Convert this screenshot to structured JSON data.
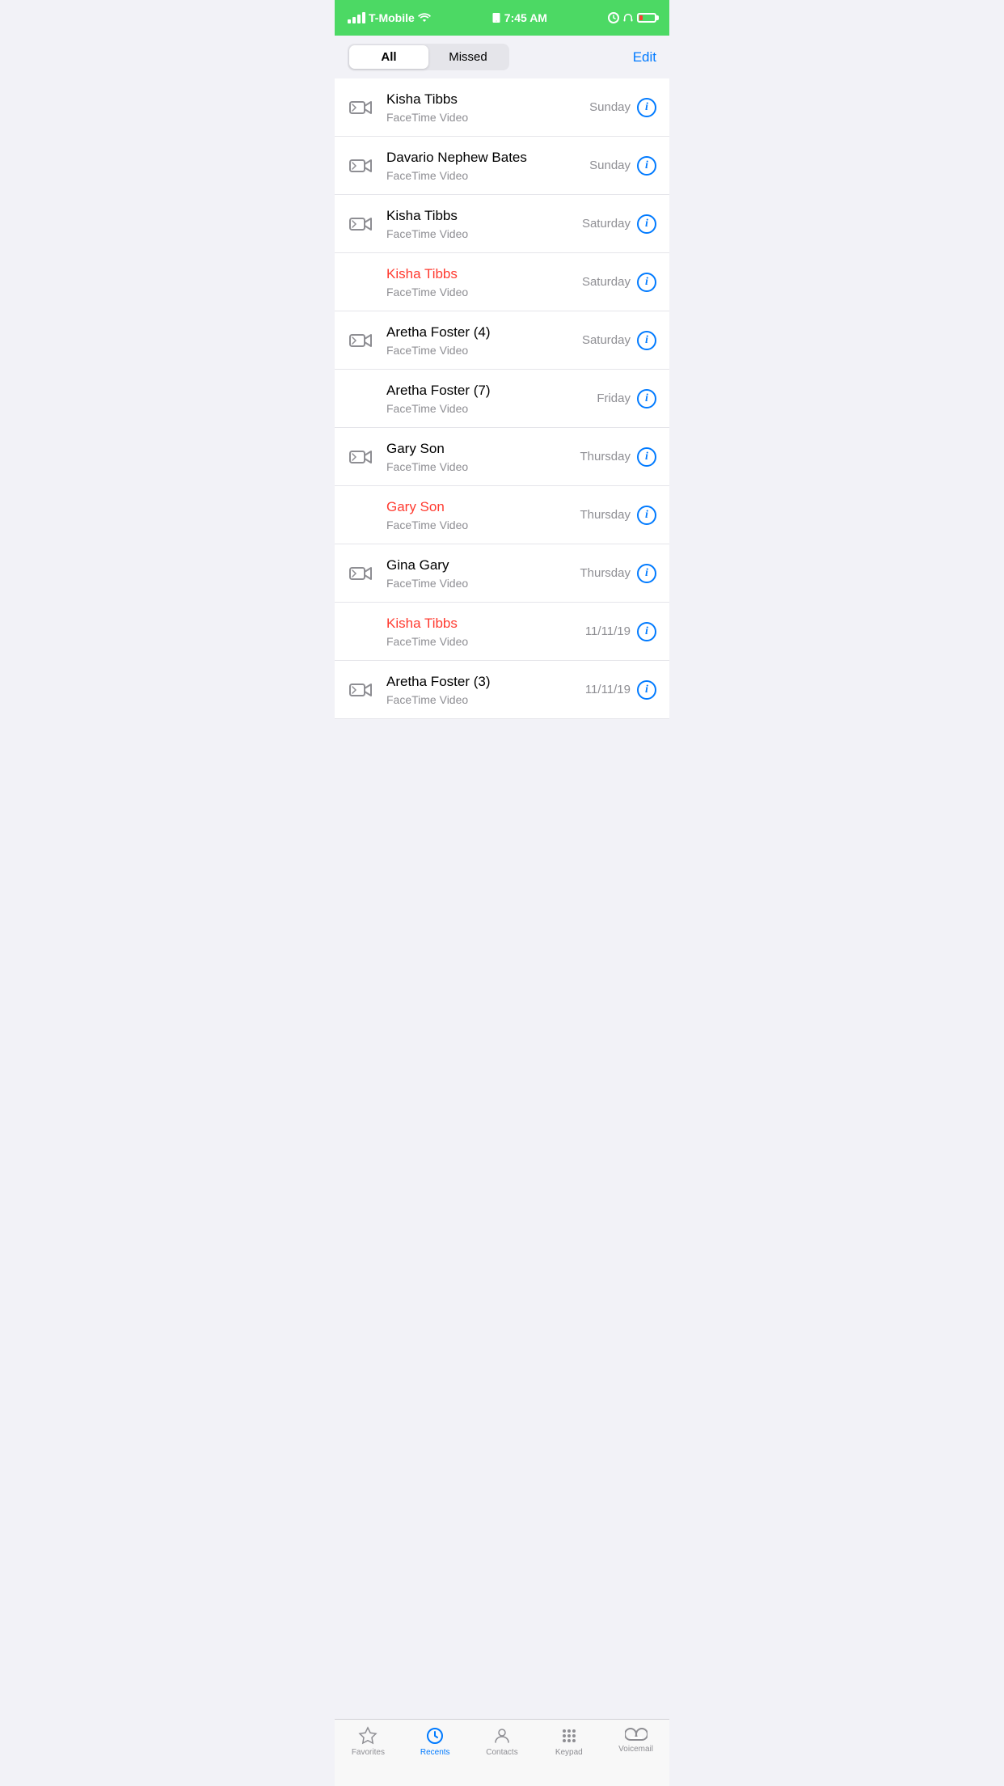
{
  "statusBar": {
    "carrier": "T-Mobile",
    "time": "7:45 AM",
    "wifiIcon": "wifi",
    "batteryLevel": "low"
  },
  "segmentControl": {
    "allLabel": "All",
    "missedLabel": "Missed",
    "activeTab": "all",
    "editLabel": "Edit"
  },
  "calls": [
    {
      "id": 1,
      "name": "Kisha Tibbs",
      "type": "FaceTime Video",
      "date": "Sunday",
      "missed": false,
      "hasArrow": true
    },
    {
      "id": 2,
      "name": "Davario Nephew Bates",
      "type": "FaceTime Video",
      "date": "Sunday",
      "missed": false,
      "hasArrow": true
    },
    {
      "id": 3,
      "name": "Kisha Tibbs",
      "type": "FaceTime Video",
      "date": "Saturday",
      "missed": false,
      "hasArrow": true
    },
    {
      "id": 4,
      "name": "Kisha Tibbs",
      "type": "FaceTime Video",
      "date": "Saturday",
      "missed": true,
      "hasArrow": false
    },
    {
      "id": 5,
      "name": "Aretha Foster (4)",
      "type": "FaceTime Video",
      "date": "Saturday",
      "missed": false,
      "hasArrow": true
    },
    {
      "id": 6,
      "name": "Aretha Foster (7)",
      "type": "FaceTime Video",
      "date": "Friday",
      "missed": false,
      "hasArrow": false
    },
    {
      "id": 7,
      "name": "Gary Son",
      "type": "FaceTime Video",
      "date": "Thursday",
      "missed": false,
      "hasArrow": true
    },
    {
      "id": 8,
      "name": "Gary Son",
      "type": "FaceTime Video",
      "date": "Thursday",
      "missed": true,
      "hasArrow": false
    },
    {
      "id": 9,
      "name": "Gina Gary",
      "type": "FaceTime Video",
      "date": "Thursday",
      "missed": false,
      "hasArrow": true
    },
    {
      "id": 10,
      "name": "Kisha Tibbs",
      "type": "FaceTime Video",
      "date": "11/11/19",
      "missed": true,
      "hasArrow": false
    },
    {
      "id": 11,
      "name": "Aretha Foster (3)",
      "type": "FaceTime Video",
      "date": "11/11/19",
      "missed": false,
      "hasArrow": true
    }
  ],
  "tabBar": {
    "items": [
      {
        "id": "favorites",
        "label": "Favorites",
        "active": false
      },
      {
        "id": "recents",
        "label": "Recents",
        "active": true
      },
      {
        "id": "contacts",
        "label": "Contacts",
        "active": false
      },
      {
        "id": "keypad",
        "label": "Keypad",
        "active": false
      },
      {
        "id": "voicemail",
        "label": "Voicemail",
        "active": false
      }
    ]
  }
}
